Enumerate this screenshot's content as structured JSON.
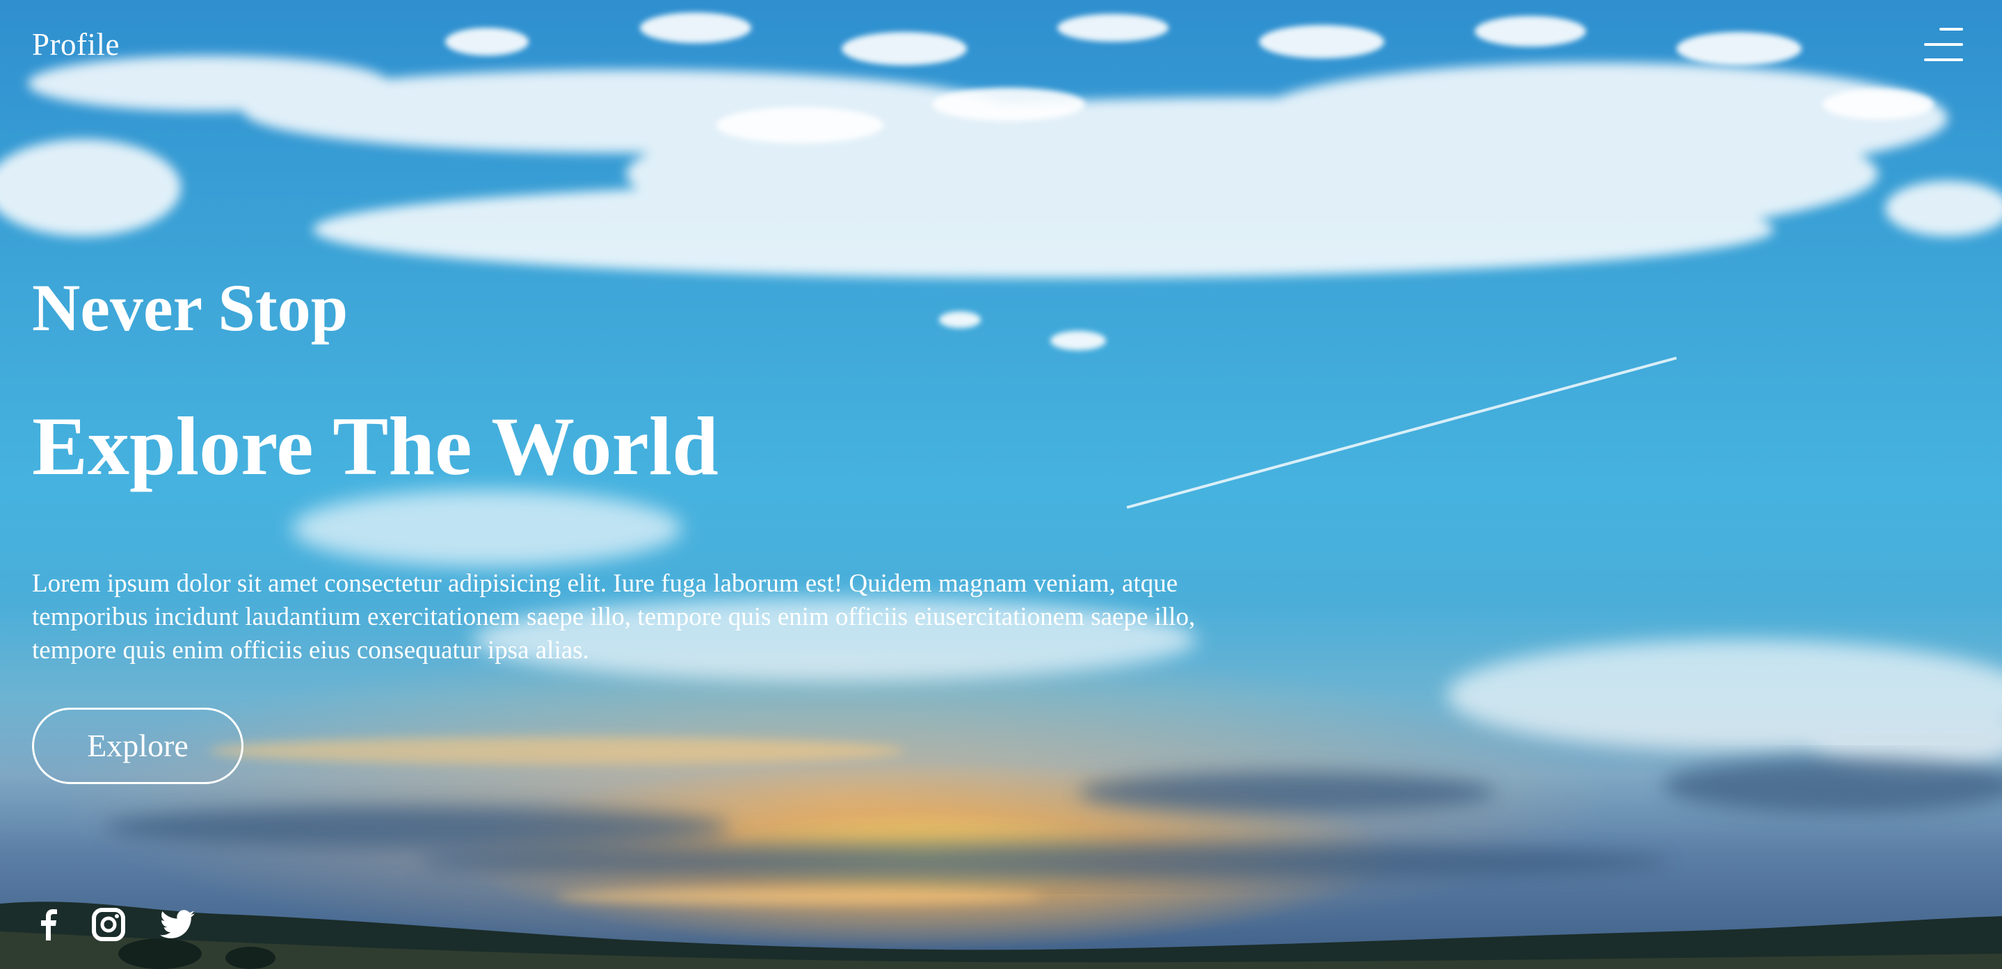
{
  "nav": {
    "profile_label": "Profile",
    "menu_icon": "hamburger-menu-icon"
  },
  "hero": {
    "subtitle": "Never Stop",
    "title": "Explore The World",
    "description": "Lorem ipsum dolor sit amet consectetur adipisicing elit. Iure fuga laborum est! Quidem magnam veniam, atque temporibus incidunt laudantium exercitationem saepe illo, tempore quis enim officiis eiusercitationem saepe illo, tempore quis enim officiis eius consequatur ipsa alias.",
    "button_label": "Explore"
  },
  "social": [
    {
      "icon": "facebook-icon"
    },
    {
      "icon": "instagram-icon"
    },
    {
      "icon": "twitter-icon"
    }
  ],
  "colors": {
    "text": "#ffffff",
    "sky": "#46b2df",
    "sun": "#ffd65a"
  }
}
